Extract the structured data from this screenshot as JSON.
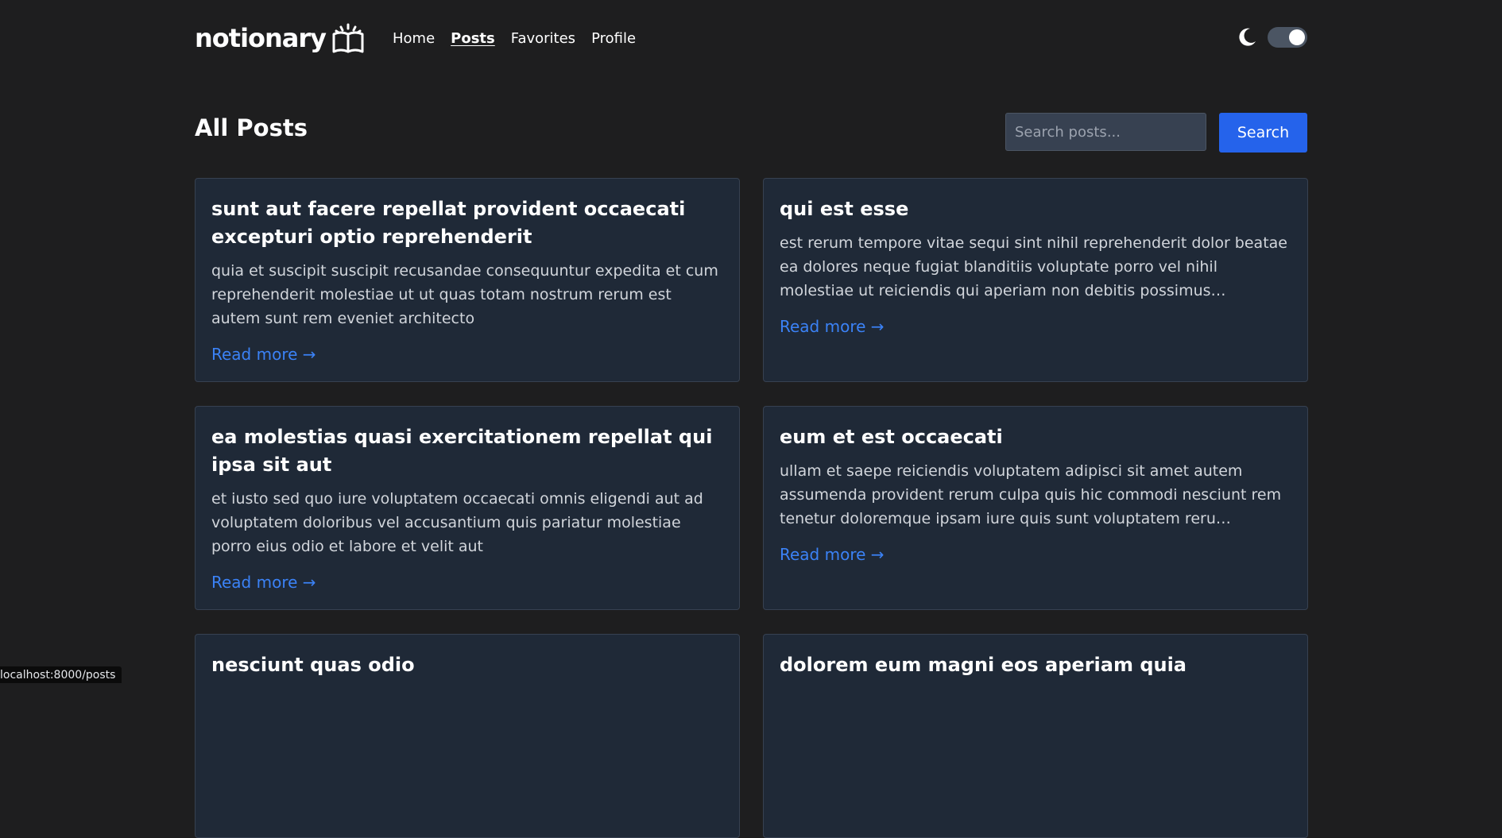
{
  "header": {
    "logo_text": "notionary",
    "logo_icon": "open-book-icon",
    "nav": [
      {
        "label": "Home"
      },
      {
        "label": "Posts"
      },
      {
        "label": "Favorites"
      },
      {
        "label": "Profile"
      }
    ],
    "theme_icon": "moon-icon"
  },
  "main": {
    "title": "All Posts",
    "search": {
      "placeholder": "Search posts...",
      "button_label": "Search"
    },
    "read_more_label": "Read more →",
    "posts": [
      {
        "title": "sunt aut facere repellat provident occaecati excepturi optio reprehenderit",
        "body": "quia et suscipit suscipit recusandae consequuntur expedita et cum reprehenderit molestiae ut ut quas totam nostrum rerum est autem sunt rem eveniet architecto"
      },
      {
        "title": "qui est esse",
        "body": "est rerum tempore vitae sequi sint nihil reprehenderit dolor beatae ea dolores neque fugiat blanditiis voluptate porro vel nihil molestiae ut reiciendis qui aperiam non debitis possimus…"
      },
      {
        "title": "ea molestias quasi exercitationem repellat qui ipsa sit aut",
        "body": "et iusto sed quo iure voluptatem occaecati omnis eligendi aut ad voluptatem doloribus vel accusantium quis pariatur molestiae porro eius odio et labore et velit aut"
      },
      {
        "title": "eum et est occaecati",
        "body": "ullam et saepe reiciendis voluptatem adipisci sit amet autem assumenda provident rerum culpa quis hic commodi nesciunt rem tenetur doloremque ipsam iure quis sunt voluptatem reru…"
      },
      {
        "title": "nesciunt quas odio",
        "body": ""
      },
      {
        "title": "dolorem eum magni eos aperiam quia",
        "body": ""
      }
    ]
  },
  "status_bar": {
    "url": "localhost:8000/posts"
  },
  "colors": {
    "background": "#1e1e1f",
    "card": "#1f2937",
    "accent": "#2563eb",
    "link": "#3b82f6"
  }
}
